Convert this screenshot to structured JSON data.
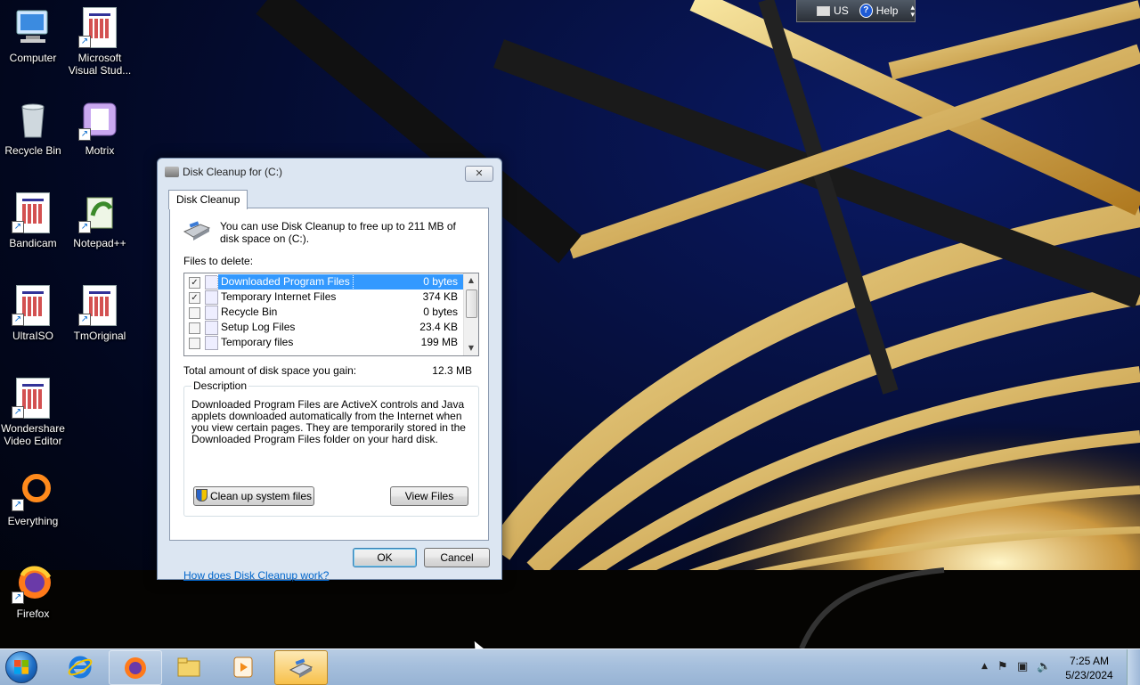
{
  "desktop": {
    "icons": [
      {
        "label": "Computer",
        "icon": "computer-icon"
      },
      {
        "label": "Microsoft Visual Stud...",
        "icon": "document-shortcut-icon"
      },
      {
        "label": "Recycle Bin",
        "icon": "recycle-bin-icon"
      },
      {
        "label": "Motrix",
        "icon": "motrix-icon"
      },
      {
        "label": "Bandicam",
        "icon": "document-shortcut-icon"
      },
      {
        "label": "Notepad++",
        "icon": "notepad-plus-plus-icon"
      },
      {
        "label": "UltraISO",
        "icon": "document-shortcut-icon"
      },
      {
        "label": "TmOriginal",
        "icon": "document-shortcut-icon"
      },
      {
        "label": "Wondershare Video Editor",
        "icon": "document-shortcut-icon"
      },
      {
        "label": "Everything",
        "icon": "everything-icon"
      },
      {
        "label": "Firefox",
        "icon": "firefox-icon"
      }
    ]
  },
  "language_bar": {
    "language": "US",
    "help": "Help"
  },
  "dialog": {
    "title": "Disk Cleanup for  (C:)",
    "close_glyph": "✕",
    "tab": "Disk Cleanup",
    "intro": "You can use Disk Cleanup to free up to 211 MB of disk space on  (C:).",
    "files_label": "Files to delete:",
    "files": [
      {
        "name": "Downloaded Program Files",
        "size": "0 bytes",
        "checked": true,
        "selected": true
      },
      {
        "name": "Temporary Internet Files",
        "size": "374 KB",
        "checked": true,
        "selected": false
      },
      {
        "name": "Recycle Bin",
        "size": "0 bytes",
        "checked": false,
        "selected": false
      },
      {
        "name": "Setup Log Files",
        "size": "23.4 KB",
        "checked": false,
        "selected": false
      },
      {
        "name": "Temporary files",
        "size": "199 MB",
        "checked": false,
        "selected": false
      }
    ],
    "total_label": "Total amount of disk space you gain:",
    "total_value": "12.3 MB",
    "description_legend": "Description",
    "description_text": "Downloaded Program Files are ActiveX controls and Java applets downloaded automatically from the Internet when you view certain pages. They are temporarily stored in the Downloaded Program Files folder on your hard disk.",
    "cleanup_system_button": "Clean up system files",
    "view_files_button": "View Files",
    "help_link": "How does Disk Cleanup work?",
    "ok_button": "OK",
    "cancel_button": "Cancel",
    "check_glyph": "✓"
  },
  "taskbar": {
    "items": [
      {
        "name": "internet-explorer-icon",
        "active": false
      },
      {
        "name": "firefox-icon",
        "active": false
      },
      {
        "name": "file-explorer-icon",
        "active": false
      },
      {
        "name": "media-player-icon",
        "active": false
      },
      {
        "name": "disk-cleanup-icon",
        "active": true
      }
    ],
    "tray": {
      "time": "7:25 AM",
      "date": "5/23/2024"
    }
  },
  "colors": {
    "selection": "#3399ff",
    "link": "#0066cc",
    "taskbar_active": "#f7c04a"
  }
}
